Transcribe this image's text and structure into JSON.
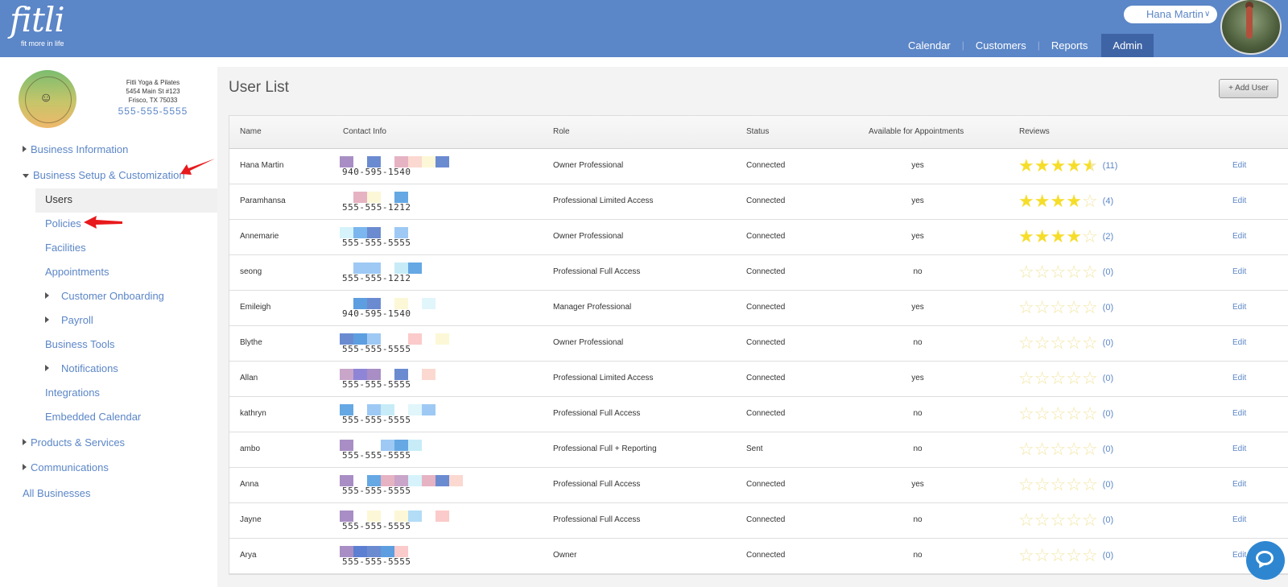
{
  "brand": {
    "logo_text": "fitli",
    "tagline": "fit more in life"
  },
  "header": {
    "user_name": "Hana Martin",
    "nav": [
      "Calendar",
      "Customers",
      "Reports",
      "Admin"
    ],
    "active_nav": "Admin"
  },
  "business": {
    "name": "Fitli Yoga & Pilates",
    "address1": "5454 Main St #123",
    "address2": "Frisco, TX 75033",
    "phone": "555-555-5555"
  },
  "sidebar": {
    "business_information": "Business Information",
    "business_setup": "Business Setup & Customization",
    "users": "Users",
    "policies": "Policies",
    "facilities": "Facilities",
    "appointments": "Appointments",
    "customer_onboarding": "Customer Onboarding",
    "payroll": "Payroll",
    "business_tools": "Business Tools",
    "notifications": "Notifications",
    "integrations": "Integrations",
    "embedded_calendar": "Embedded Calendar",
    "products_services": "Products & Services",
    "communications": "Communications",
    "all_businesses": "All Businesses"
  },
  "main": {
    "title": "User List",
    "add_user_label": "+ Add User",
    "columns": [
      "Name",
      "Contact Info",
      "Role",
      "Status",
      "Available for Appointments",
      "Reviews"
    ],
    "edit_label": "Edit"
  },
  "users": [
    {
      "name": "Hana Martin",
      "phone": "940-595-1540",
      "role": "Owner Professional",
      "status": "Connected",
      "available": "yes",
      "rating": 4.5,
      "review_count": "(11)",
      "swatches": [
        "#a98ec5",
        null,
        "#6b8bd1",
        null,
        "#e6b3c3",
        "#fbd9d0",
        "#fcf7d6",
        "#6b8bd1"
      ]
    },
    {
      "name": "Paramhansa",
      "phone": "555-555-1212",
      "role": "Professional Limited Access",
      "status": "Connected",
      "available": "yes",
      "rating": 4,
      "review_count": "(4)",
      "swatches": [
        null,
        "#e6b3c3",
        "#fcf7d6",
        null,
        "#65a8e4"
      ]
    },
    {
      "name": "Annemarie",
      "phone": "555-555-5555",
      "role": "Owner Professional",
      "status": "Connected",
      "available": "yes",
      "rating": 4,
      "review_count": "(2)",
      "swatches": [
        "#d6f3fb",
        "#7bb7ee",
        "#6b8bd1",
        null,
        "#9ec9f4"
      ]
    },
    {
      "name": "seong",
      "phone": "555-555-1212",
      "role": "Professional Full Access",
      "status": "Connected",
      "available": "no",
      "rating": 0,
      "review_count": "(0)",
      "swatches": [
        null,
        "#9ec9f4",
        "#9ec9f4",
        null,
        "#c7ecf7",
        "#65a8e4"
      ]
    },
    {
      "name": "Emileigh",
      "phone": "940-595-1540",
      "role": "Manager Professional",
      "status": "Connected",
      "available": "yes",
      "rating": 0,
      "review_count": "(0)",
      "swatches": [
        null,
        "#5c9ee0",
        "#6b8bd1",
        null,
        "#fcf7d6",
        null,
        "#e1f6fb"
      ]
    },
    {
      "name": "Blythe",
      "phone": "555-555-5555",
      "role": "Owner Professional",
      "status": "Connected",
      "available": "no",
      "rating": 0,
      "review_count": "(0)",
      "swatches": [
        "#6b8bd1",
        "#5c9ee0",
        "#9ec9f4",
        null,
        null,
        "#fbcaca",
        null,
        "#fcf7d6"
      ]
    },
    {
      "name": "Allan",
      "phone": "555-555-5555",
      "role": "Professional Limited Access",
      "status": "Connected",
      "available": "yes",
      "rating": 0,
      "review_count": "(0)",
      "swatches": [
        "#c9a5c9",
        "#8e85d6",
        "#a98ec5",
        null,
        "#6b8bd1",
        null,
        "#fbd9d0"
      ]
    },
    {
      "name": "kathryn",
      "phone": "555-555-5555",
      "role": "Professional Full Access",
      "status": "Connected",
      "available": "no",
      "rating": 0,
      "review_count": "(0)",
      "swatches": [
        "#65a8e4",
        null,
        "#9ec9f4",
        "#c7ecf7",
        null,
        "#e1f6fb",
        "#9ec9f4"
      ]
    },
    {
      "name": "ambo",
      "phone": "555-555-5555",
      "role": "Professional Full + Reporting",
      "status": "Sent",
      "available": "no",
      "rating": 0,
      "review_count": "(0)",
      "swatches": [
        "#a98ec5",
        null,
        null,
        "#9ec9f4",
        "#65a8e4",
        "#c7ecf7"
      ]
    },
    {
      "name": "Anna",
      "phone": "555-555-5555",
      "role": "Professional Full Access",
      "status": "Connected",
      "available": "yes",
      "rating": 0,
      "review_count": "(0)",
      "swatches": [
        "#a98ec5",
        null,
        "#65a8e4",
        "#e6b3c3",
        "#c9a5c9",
        "#d6f3fb",
        "#e6b3c3",
        "#6b8bd1",
        "#fbd9d0"
      ]
    },
    {
      "name": "Jayne",
      "phone": "555-555-5555",
      "role": "Professional Full Access",
      "status": "Connected",
      "available": "no",
      "rating": 0,
      "review_count": "(0)",
      "swatches": [
        "#a98ec5",
        null,
        "#fcf7d6",
        null,
        "#fcf7d6",
        "#b3dcf6",
        null,
        "#fbcaca"
      ]
    },
    {
      "name": "Arya",
      "phone": "555-555-5555",
      "role": "Owner",
      "status": "Connected",
      "available": "no",
      "rating": 0,
      "review_count": "(0)",
      "swatches": [
        "#a98ec5",
        "#5c7fd1",
        "#6b8bd1",
        "#5c9ee0",
        "#fbcaca"
      ]
    }
  ],
  "colors": {
    "header": "#5b86c7",
    "link": "#5b86c7",
    "star": "#f6dd2a",
    "annotation_arrow": "#e8191c"
  }
}
